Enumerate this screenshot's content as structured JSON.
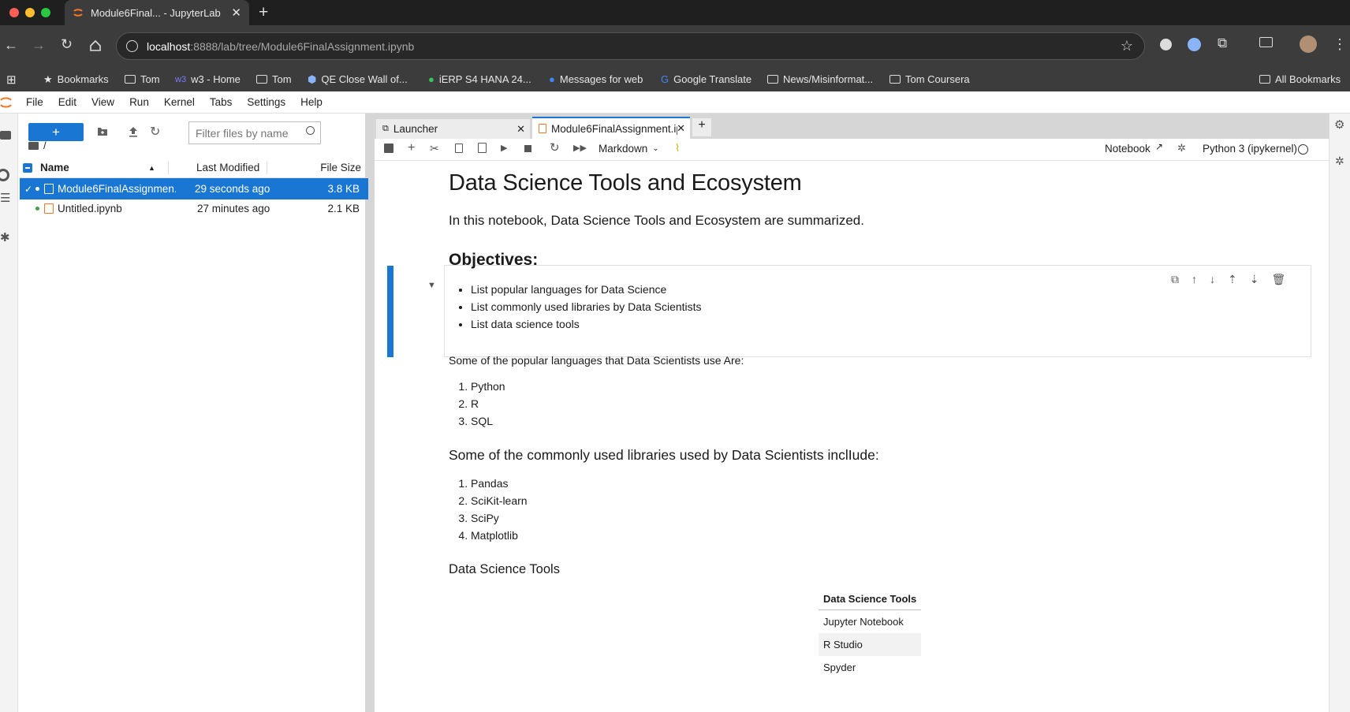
{
  "browser": {
    "tab_title": "Module6Final... - JupyterLab",
    "url_host": "localhost",
    "url_path": ":8888/lab/tree/Module6FinalAssignment.ipynb",
    "bookmarks": [
      "Bookmarks",
      "Tom",
      "w3 - Home",
      "Tom",
      "QE Close Wall of...",
      "iERP S4 HANA 24...",
      "Messages for web",
      "Google Translate",
      "News/Misinformat...",
      "Tom Coursera"
    ],
    "all_bookmarks": "All Bookmarks"
  },
  "menu": [
    "File",
    "Edit",
    "View",
    "Run",
    "Kernel",
    "Tabs",
    "Settings",
    "Help"
  ],
  "filebrowser": {
    "filter_placeholder": "Filter files by name",
    "path": "/",
    "col_name": "Name",
    "col_modified": "Last Modified",
    "col_size": "File Size",
    "files": [
      {
        "name": "Module6FinalAssignmen...",
        "modified": "29 seconds ago",
        "size": "3.8 KB",
        "selected": true
      },
      {
        "name": "Untitled.ipynb",
        "modified": "27 minutes ago",
        "size": "2.1 KB",
        "selected": false
      }
    ]
  },
  "tabs": {
    "launcher": "Launcher",
    "notebook": "Module6FinalAssignment.ip"
  },
  "nbtoolbar": {
    "cell_type": "Markdown",
    "notebook_label": "Notebook",
    "kernel": "Python 3 (ipykernel)"
  },
  "notebook": {
    "title": "Data Science Tools and Ecosystem",
    "intro": "In this notebook, Data Science Tools and Ecosystem are summarized.",
    "objectives_heading": "Objectives:",
    "objectives": [
      "List popular languages for Data Science",
      "List commonly used libraries by Data Scientists",
      "List data science tools"
    ],
    "languages_intro": "Some of the popular languages that Data Scientists use Are:",
    "languages": [
      "Python",
      "R",
      "SQL"
    ],
    "libraries_heading": "Some of the commonly used libraries used by Data Scientists inclIude:",
    "libraries": [
      "Pandas",
      "SciKit-learn",
      "SciPy",
      "Matplotlib"
    ],
    "tools_heading": "Data Science Tools",
    "tools_table_header": "Data Science Tools",
    "tools": [
      "Jupyter Notebook",
      "R Studio",
      "Spyder"
    ]
  }
}
